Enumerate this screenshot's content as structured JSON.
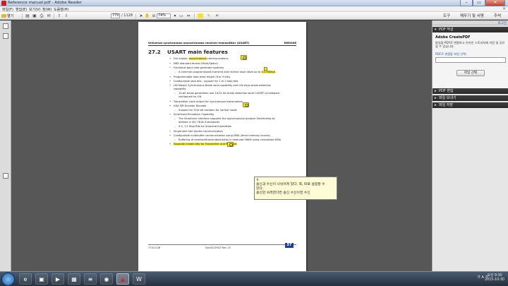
{
  "window": {
    "title": "Reference manual.pdf - Adobe Reader",
    "minimize": "–",
    "maximize": "▭",
    "close": "✕"
  },
  "menu": [
    "파일(F)",
    "편집(E)",
    "보기(V)",
    "창(W)",
    "도움말(H)"
  ],
  "menu_close": "×",
  "toolbar": {
    "open_label": "열기",
    "page_current": "770",
    "page_total": "/ 1128",
    "zoom": "74%",
    "tools": "도구",
    "sign": "채우기 및 서명",
    "comment": "주석"
  },
  "right_panel": {
    "login": "로그인",
    "pdf_create": "PDF 작성",
    "service_title": "Adobe CreatePDF",
    "service_desc": "파일을 PDF로 변환하고 온라인 스토리지에 저장 및 공유할 수 있습니다.",
    "convert_label": "PDF로 변환할 파일 선택:",
    "select_button": "파일 선택",
    "pdf_edit": "PDF 편집",
    "send_files": "파일 보내기",
    "store_files": "파일 저장"
  },
  "document": {
    "header_left": "Universal synchronous asynchronous receiver transmitter (USART)",
    "header_right": "RM0008",
    "section_number": "27.2",
    "section_title": "USART main features",
    "features": [
      {
        "text_before": "Full duplex, ",
        "highlight": "asynchronous",
        "text_after": " communications"
      },
      {
        "text": "NRZ standard format (Mark/Space)"
      },
      {
        "text": "Fractional baud rate generator systems"
      },
      {
        "text_before": "A common programmable transmit and receive baud rates up to ",
        "highlight": "4.5 MBits/s",
        "text_after": ""
      },
      {
        "text": "Programmable data word length (8 or 9 bits)"
      },
      {
        "text": "Configurable stop bits - support for 1 or 2 stop bits"
      },
      {
        "text": "LIN Master Synchronous Break send capability and LIN slave break detection"
      },
      {
        "text": "capability"
      },
      {
        "text": "13-bit break generation and 10/11 bit break detection when USART is hardware"
      },
      {
        "text": "configured for LIN"
      },
      {
        "text": "Transmitter clock output for synchronous transmission"
      },
      {
        "text": "IrDA SIR Encoder Decoder"
      },
      {
        "text": "Support for 3/16 bit duration for normal mode"
      },
      {
        "text": "Smartcard Emulation Capability"
      },
      {
        "text": "The Smartcard interface supports the asynchronous protocol Smartcards as"
      },
      {
        "text": "defined in ISO 7816-3 standards"
      },
      {
        "text": "0.5, 1.5 Stop Bits for Smartcard operation"
      },
      {
        "text": "Single wire half duplex communication"
      },
      {
        "text": "Configurable multibuffer communication using DMA (direct memory access)"
      },
      {
        "text": "Buffering of received/transmitted bytes in reserved SRAM using centralized DMA"
      },
      {
        "highlight": "Separate enable bits for Transmitter and Receiver"
      }
    ],
    "footer_left": "770/1128",
    "footer_center": "DocID13902 Rev 15",
    "footer_logo": "ST"
  },
  "note_popup": {
    "author": "#",
    "lines": [
      "송신과 수신이 나뉘어져 있다. 즉, 따로 설정할 수",
      "있다.",
      "송신만 쓰려한다면 송신 수신이면 수신"
    ]
  },
  "taskbar": {
    "tray_language": "가 A 가",
    "time": "오전 9:30",
    "date": "2015-10-30"
  }
}
